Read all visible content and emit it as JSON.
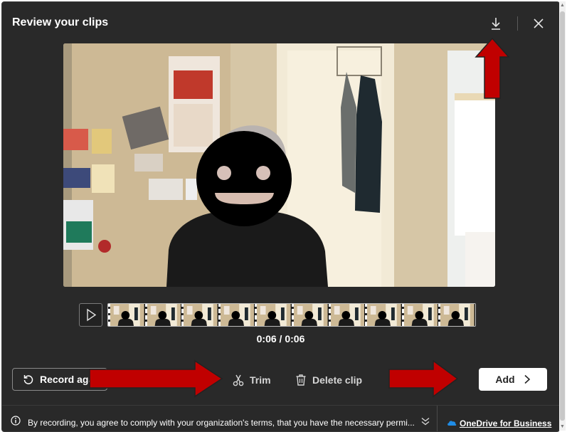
{
  "dialog": {
    "title": "Review your clips",
    "download_icon": "download-icon",
    "close_icon": "close-icon"
  },
  "player": {
    "play_icon": "play-icon",
    "current_time": "0:06",
    "duration": "0:06",
    "time_separator": "/",
    "thumbnail_count": 10
  },
  "actions": {
    "record_again_label": "Record again",
    "trim_label": "Trim",
    "delete_label": "Delete clip",
    "add_label": "Add"
  },
  "footer": {
    "notice": "By recording, you agree to comply with your organization's terms, that you have the necessary permi...",
    "storage_link": "OneDrive for Business"
  },
  "colors": {
    "dialog_bg": "#292929",
    "annotation_arrow": "#c00000",
    "primary_button": "#ffffff"
  }
}
